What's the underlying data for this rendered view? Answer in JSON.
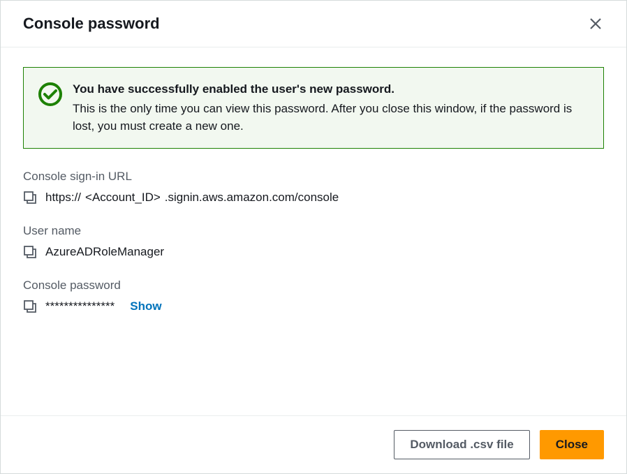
{
  "modal": {
    "title": "Console password"
  },
  "alert": {
    "title": "You have successfully enabled the user's new password.",
    "description": "This is the only time you can view this password. After you close this window, if the password is lost, you must create a new one."
  },
  "fields": {
    "signin_url": {
      "label": "Console sign-in URL",
      "prefix": "https://",
      "account_placeholder": "<Account_ID>",
      "suffix": ".signin.aws.amazon.com/console"
    },
    "username": {
      "label": "User name",
      "value": "AzureADRoleManager"
    },
    "password": {
      "label": "Console password",
      "masked": "***************",
      "show_label": "Show"
    }
  },
  "footer": {
    "download": "Download .csv file",
    "close": "Close"
  }
}
